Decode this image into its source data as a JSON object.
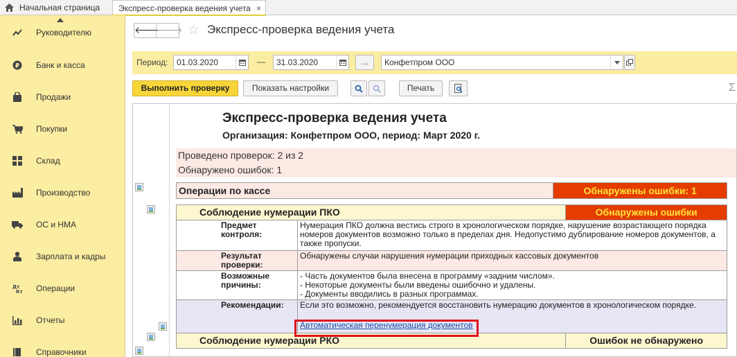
{
  "tabs": {
    "home_label": "Начальная страница",
    "active_label": "Экспресс-проверка ведения учета",
    "close_glyph": "×"
  },
  "sidebar": {
    "items": [
      {
        "label": "Руководителю",
        "icon": "chart-line-icon"
      },
      {
        "label": "Банк и касса",
        "icon": "ruble-coin-icon"
      },
      {
        "label": "Продажи",
        "icon": "shopping-bag-icon"
      },
      {
        "label": "Покупки",
        "icon": "shopping-cart-icon"
      },
      {
        "label": "Склад",
        "icon": "warehouse-grid-icon"
      },
      {
        "label": "Производство",
        "icon": "factory-icon"
      },
      {
        "label": "ОС и НМА",
        "icon": "truck-icon"
      },
      {
        "label": "Зарплата и кадры",
        "icon": "person-icon"
      },
      {
        "label": "Операции",
        "icon": "debit-credit-icon"
      },
      {
        "label": "Отчеты",
        "icon": "bar-chart-icon"
      },
      {
        "label": "Справочники",
        "icon": "book-icon"
      }
    ]
  },
  "header": {
    "title": "Экспресс-проверка ведения учета",
    "back_glyph": "🡐",
    "forward_glyph": "🡒",
    "star_glyph": "☆"
  },
  "period": {
    "label": "Период:",
    "date_from": "01.03.2020",
    "dash": "—",
    "date_to": "31.03.2020",
    "dots_label": "...",
    "organization": "Конфетпром ООО"
  },
  "toolbar": {
    "run_label": "Выполнить проверку",
    "settings_label": "Показать настройки",
    "print_label": "Печать",
    "sigma_glyph": "Σ"
  },
  "report": {
    "title": "Экспресс-проверка ведения учета",
    "subtitle": "Организация: Конфетпром ООО, период: Март 2020 г.",
    "checks_done": "Проведено проверок: 2 из 2",
    "errors_found": "Обнаружено ошибок: 1",
    "section": {
      "name": "Операции по кассе",
      "status": "Обнаружены ошибки: 1"
    },
    "check1": {
      "name": "Соблюдение нумерации ПКО",
      "status": "Обнаружены ошибки",
      "rows": [
        {
          "key": "Предмет контроля:",
          "value": "Нумерация ПКО должна вестись строго в хронологическом порядке, нарушение возрастающего порядка номеров документов возможно только в пределах дня. Недопустимо дублирование номеров документов, а также пропуски."
        },
        {
          "key": "Результат проверки:",
          "value": "Обнаружены случаи нарушения нумерации приходных кассовых документов"
        },
        {
          "key": "Возможные причины:",
          "lines": [
            "- Часть документов была внесена в программу «задним числом».",
            "- Некоторые документы были введены ошибочно и удалены.",
            "- Документы вводились в разных программах."
          ]
        },
        {
          "key": "Рекомендации:",
          "value": "Если это возможно, рекомендуется восстановить нумерацию документов в хронологическом порядке."
        }
      ],
      "link": "Автоматическая перенумерация документов"
    },
    "check2": {
      "name": "Соблюдение нумерации РКО",
      "status": "Ошибок не обнаружено"
    }
  },
  "colors": {
    "sidebar_bg": "#fbeda1",
    "accent_button": "#f7d539",
    "error_fill": "#e53c00",
    "error_text": "#ffe43a",
    "highlight_border": "#e0121c"
  }
}
